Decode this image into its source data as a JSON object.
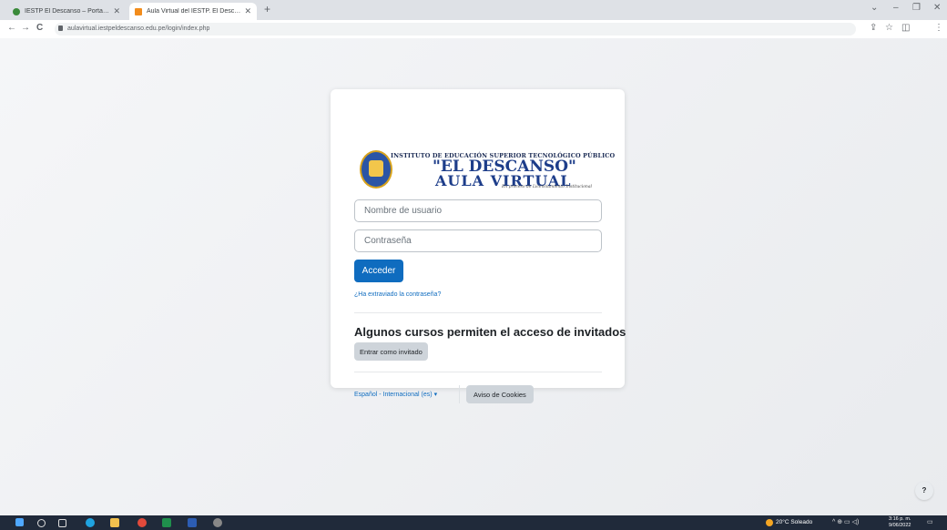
{
  "browser": {
    "tabs": [
      {
        "title": "IESTP El Descanso – Portal Web I",
        "close": "✕",
        "active": false,
        "favicon_color": "#3a8a3a"
      },
      {
        "title": "Aula Virtual del IESTP. El Descans",
        "close": "✕",
        "active": true,
        "favicon_color": "#f28c1b"
      }
    ],
    "new_tab": "+",
    "window_controls": {
      "tabsearch": "⌄",
      "minimize": "–",
      "restore": "❐",
      "close": "✕"
    },
    "nav": {
      "back": "←",
      "forward": "→",
      "reload": "C"
    },
    "url": "aulavirtual.iestpeldescanso.edu.pe/login/index.php",
    "toolbar": {
      "share": "⇪",
      "star": "☆",
      "panel": "◫",
      "menu": "⋮"
    }
  },
  "logo": {
    "line1": "INSTITUTO DE EDUCACIÓN SUPERIOR TECNOLÓGICO PÚBLICO",
    "line2": "\"EL DESCANSO\"",
    "line3": "AULA VIRTUAL",
    "line4": "En proceso de Licenciamiento Institucional"
  },
  "login": {
    "username_placeholder": "Nombre de usuario",
    "password_placeholder": "Contraseña",
    "submit_label": "Acceder",
    "forgot_link": "¿Ha extraviado la contraseña?"
  },
  "guest": {
    "heading": "Algunos cursos permiten el acceso de invitados",
    "button_label": "Entrar como invitado"
  },
  "footer": {
    "language": "Español - Internacional (es)",
    "language_caret": "▾",
    "cookies_label": "Aviso de Cookies"
  },
  "help": {
    "label": "?"
  },
  "taskbar": {
    "weather": "20°C Soleado",
    "tray": "^ ⊕ ▭ ◁)",
    "time": "3:16 p. m.",
    "date": "9/06/2022",
    "notification": "▭"
  },
  "colors": {
    "primary": "#0f6cbf",
    "secondary_btn": "#ced4da",
    "taskbar": "#202a3a"
  }
}
